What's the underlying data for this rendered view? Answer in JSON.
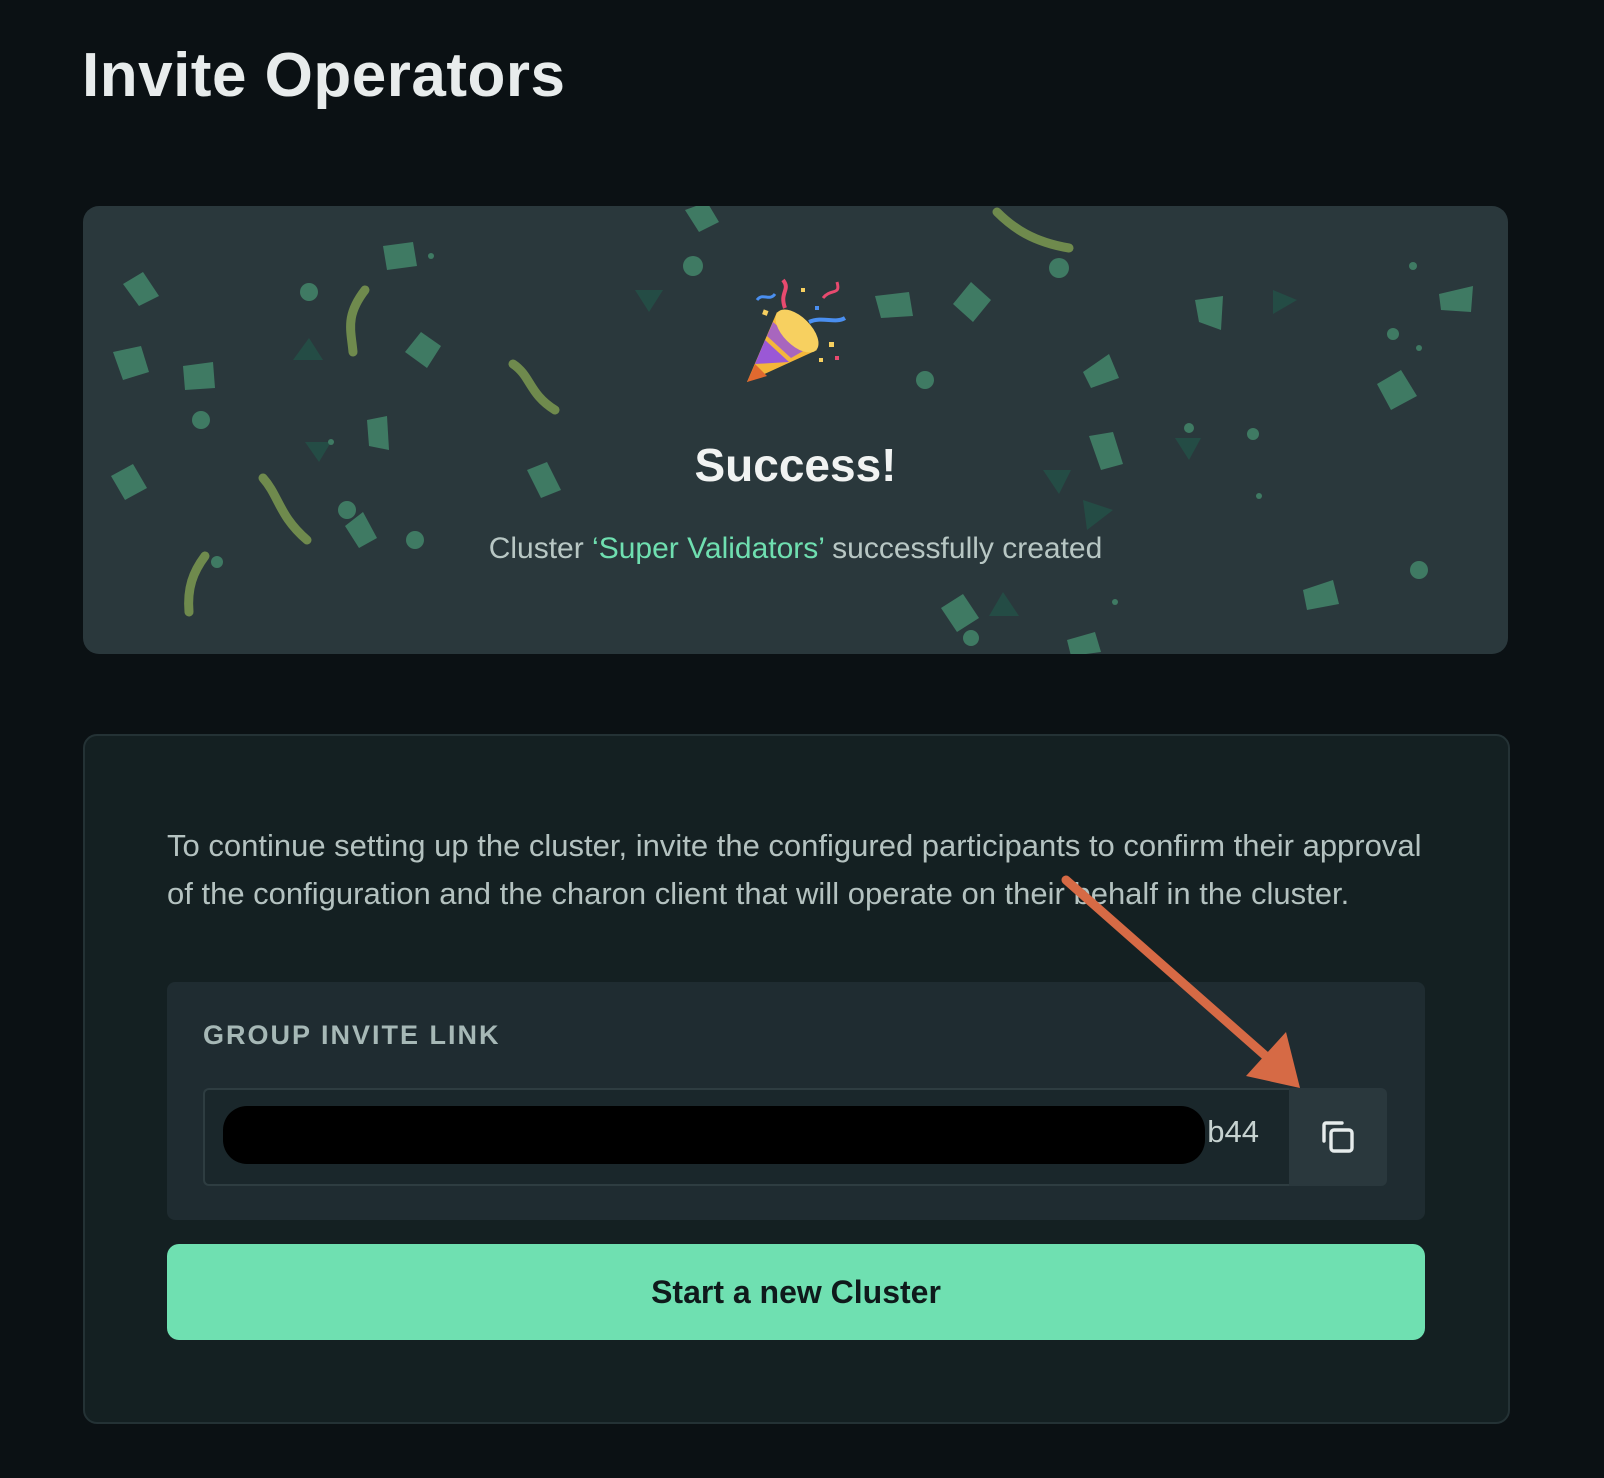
{
  "page": {
    "title": "Invite Operators"
  },
  "success_banner": {
    "icon": "party-popper-icon",
    "heading": "Success!",
    "message_prefix": "Cluster ",
    "cluster_name": "‘Super Validators’",
    "message_suffix": " successfully created"
  },
  "invite": {
    "description": "To continue setting up the cluster, invite the configured participants to confirm their approval of the configuration and the charon client that will operate on their behalf in the cluster.",
    "link_label": "GROUP INVITE LINK",
    "link_visible_tail": "b44",
    "copy_icon": "copy-icon",
    "start_button_label": "Start a new Cluster"
  },
  "colors": {
    "background": "#0b1114",
    "banner": "#2a383c",
    "accent": "#6fe0b1",
    "annotation_arrow": "#d66a45"
  }
}
